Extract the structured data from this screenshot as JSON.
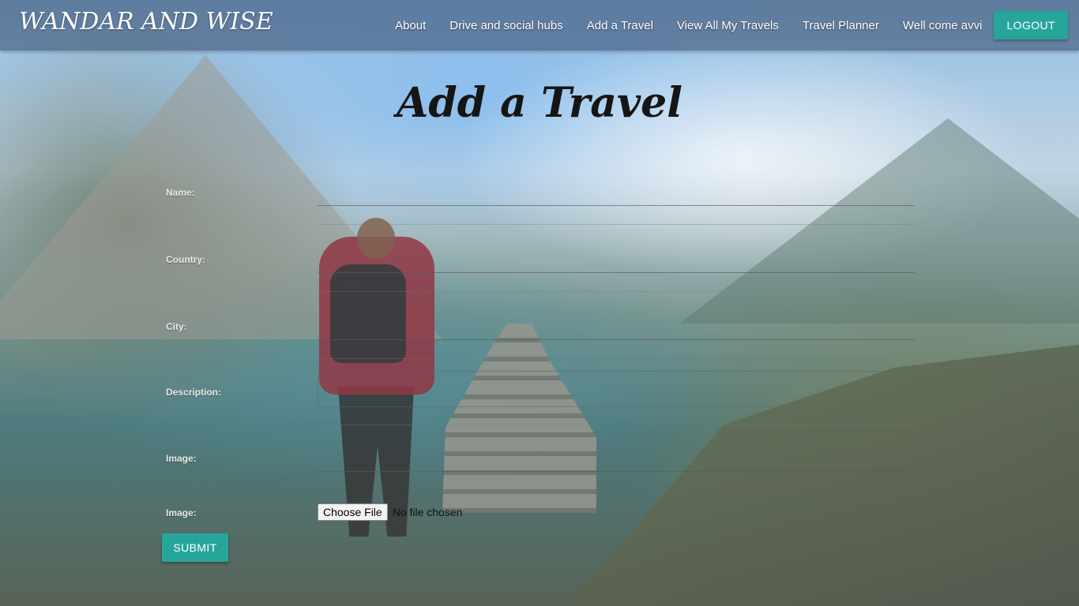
{
  "navbar": {
    "brand": "WANDAR AND WISE",
    "links": [
      "About",
      "Drive and social hubs",
      "Add a Travel",
      "View All My Travels",
      "Travel Planner",
      "Well come avvi"
    ],
    "logout_label": "LOGOUT",
    "accent_color": "#26a69a"
  },
  "page": {
    "title": "Add a Travel"
  },
  "form": {
    "name_label": "Name:",
    "country_label": "Country:",
    "city_label": "City:",
    "description_label": "Description:",
    "image_label": "Image:",
    "image_file_label": "Image:",
    "choose_file_label": "Choose File",
    "file_status": "No file chosen",
    "submit_label": "SUBMIT"
  }
}
